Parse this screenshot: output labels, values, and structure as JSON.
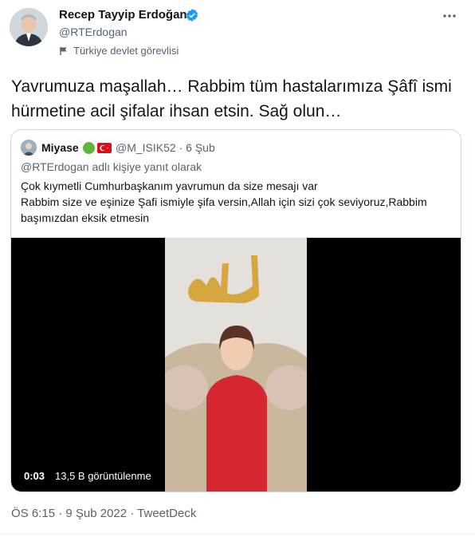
{
  "author": {
    "name": "Recep Tayyip Erdoğan",
    "handle": "@RTErdogan",
    "account_label": "Türkiye devlet görevlisi"
  },
  "tweet": {
    "text": "Yavrumuza maşallah… Rabbim tüm hastalarımıza Şâfî ismi hürmetine acil şifalar ihsan etsin. Sağ olun…"
  },
  "quoted": {
    "name": "Miyase",
    "handle": "@M_ISIK52",
    "sep": "·",
    "date": "6 Şub",
    "reply_context": "@RTErdogan adlı kişiye yanıt olarak",
    "lines": [
      "Çok kıymetli Cumhurbaşkanım yavrumun da size mesajı var",
      "Rabbim size ve eşinize Şafi ismiyle şifa versin,Allah için sizi çok seviyoruz,Rabbim başımızdan eksik etmesin"
    ],
    "video": {
      "time": "0:03",
      "views": "13,5 B görüntülenme"
    }
  },
  "meta": {
    "text": "ÖS 6:15 · 9 Şub 2022 · TweetDeck"
  },
  "colors": {
    "verified": "#1d9bf0",
    "secondary_text": "#536471",
    "border": "#cfd9de"
  },
  "icons": [
    "verified-icon",
    "flag-icon",
    "more-icon",
    "turkey-flag-icon"
  ]
}
